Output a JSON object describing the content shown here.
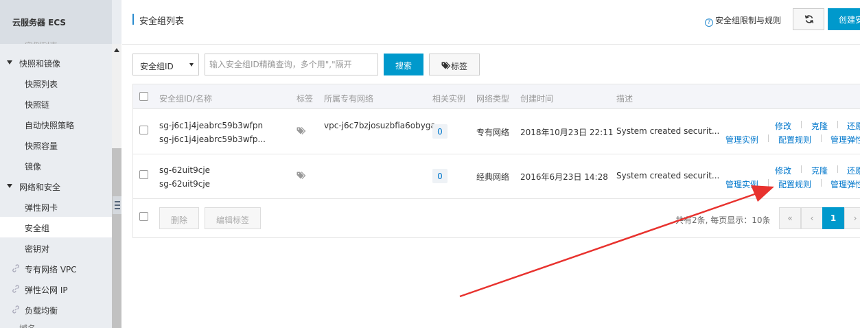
{
  "sidebar": {
    "title": "云服务器 ECS",
    "cut_top_label": "实例列表",
    "groups": [
      {
        "label": "快照和镜像"
      },
      {
        "label": "网络和安全"
      }
    ],
    "items": [
      {
        "label": "快照列表"
      },
      {
        "label": "快照链"
      },
      {
        "label": "自动快照策略"
      },
      {
        "label": "快照容量"
      },
      {
        "label": "镜像"
      },
      {
        "label": "弹性网卡"
      },
      {
        "label": "安全组"
      },
      {
        "label": "密钥对"
      }
    ],
    "links": [
      {
        "label": "专有网络 VPC"
      },
      {
        "label": "弹性公网 IP"
      },
      {
        "label": "负载均衡"
      }
    ],
    "cut_bottom_label": "域名"
  },
  "header": {
    "title": "安全组列表",
    "help_link": "安全组限制与规则",
    "help_icon_glyph": "?",
    "refresh_icon": "refresh-icon",
    "create_label": "创建安全组"
  },
  "search": {
    "type_value": "安全组ID",
    "placeholder": "输入安全组ID精确查询，多个用\",\"隔开",
    "search_label": "搜索",
    "tag_label": "标签"
  },
  "table": {
    "columns": {
      "id_name": "安全组ID/名称",
      "tags": "标签",
      "vpc": "所属专有网络",
      "instances": "相关实例",
      "network_type": "网络类型",
      "created": "创建时间",
      "description": "描述"
    },
    "rows": [
      {
        "id": "sg-j6c1j4jeabrc59b3wfpn",
        "name": "sg-j6c1j4jeabrc59b3wfp...",
        "vpc": "vpc-j6c7bzjosuzbfia6obyga",
        "instances": "0",
        "network_type": "专有网络",
        "created": "2018年10月23日 22:11",
        "description": "System created securit...",
        "actions_top": [
          "修改",
          "克隆",
          "还原"
        ],
        "actions_bottom": [
          "管理实例",
          "配置规则",
          "管理弹性"
        ]
      },
      {
        "id": "sg-62uit9cje",
        "name": "sg-62uit9cje",
        "vpc": "",
        "instances": "0",
        "network_type": "经典网络",
        "created": "2016年6月23日 14:28",
        "description": "System created securit...",
        "actions_top": [
          "修改",
          "克隆",
          "还原"
        ],
        "actions_bottom": [
          "管理实例",
          "配置规则",
          "管理弹性"
        ]
      }
    ],
    "footer": {
      "delete_label": "删除",
      "edit_tags_label": "编辑标签",
      "summary": "共有2条, 每页显示：10条",
      "pager": {
        "first": "«",
        "prev": "‹",
        "current": "1",
        "next": "›"
      }
    }
  },
  "colors": {
    "accent": "#0099cc",
    "link": "#0077cc",
    "annotation": "#e8322e"
  }
}
